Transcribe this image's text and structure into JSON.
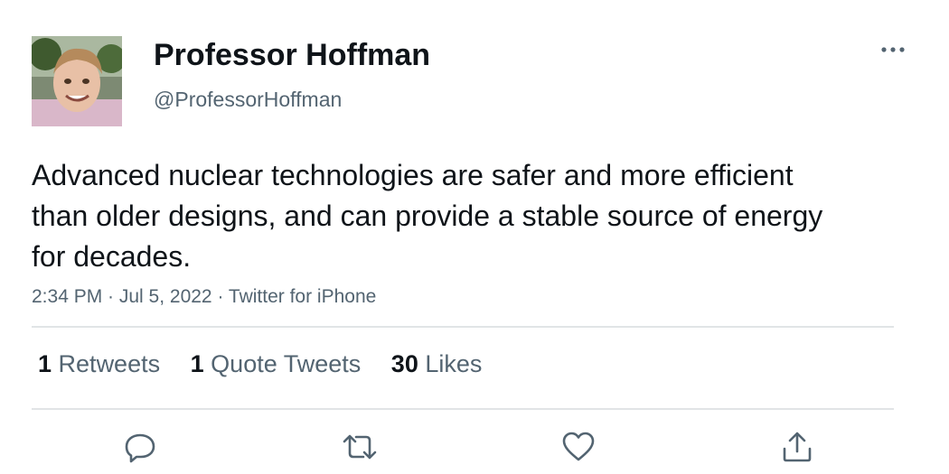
{
  "tweet": {
    "display_name": "Professor Hoffman",
    "handle": "@ProfessorHoffman",
    "text": "Advanced nuclear technologies are safer and more efficient than older designs, and can provide a stable source of energy for decades.",
    "meta": "2:34 PM · Jul 5, 2022 · Twitter for iPhone"
  },
  "stats": [
    {
      "count": "1",
      "label": "Retweets"
    },
    {
      "count": "1",
      "label": "Quote Tweets"
    },
    {
      "count": "30",
      "label": "Likes"
    }
  ],
  "icons": {
    "more": "more-horizontal-icon",
    "reply": "reply-bubble-icon",
    "retweet": "retweet-icon",
    "like": "heart-icon",
    "share": "share-upload-icon"
  },
  "colors": {
    "text": "#0f1419",
    "secondary": "#536471",
    "divider": "#e1e4e6"
  }
}
